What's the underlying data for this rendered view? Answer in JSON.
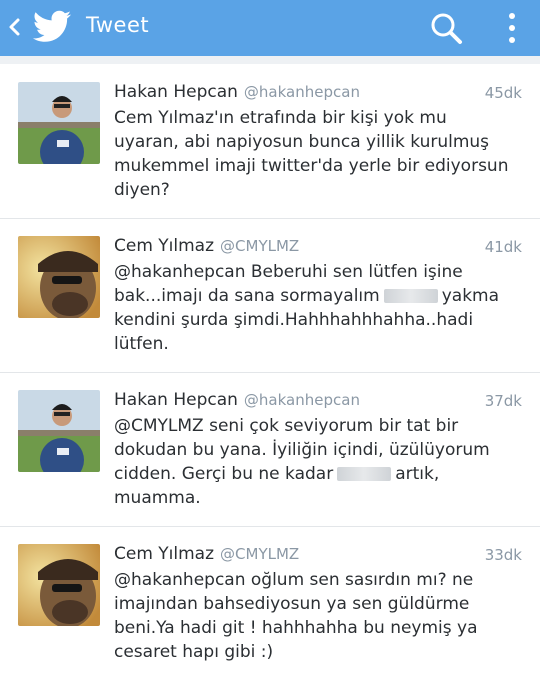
{
  "header": {
    "title": "Tweet",
    "accent_color": "#5aa3e6",
    "icons": [
      "back-chevron-icon",
      "twitter-bird-icon",
      "search-icon",
      "more-vert-icon"
    ]
  },
  "tweets": [
    {
      "name": "Hakan Hepcan",
      "handle": "@hakanhepcan",
      "time": "45dk",
      "text": "Cem Yılmaz'ın etrafında bir kişi yok mu uyaran, abi napiyosun bunca yillik kurulmuş mukemmel imaji twitter'da yerle bir ediyorsun diyen?"
    },
    {
      "name": "Cem Yılmaz",
      "handle": "@CMYLMZ",
      "time": "41dk",
      "text_before": "@hakanhepcan Beberuhi sen lütfen işine bak...imajı da sana sormayalım",
      "text_after": "yakma kendini şurda şimdi.Hahhhahhhahha..hadi lütfen."
    },
    {
      "name": "Hakan Hepcan",
      "handle": "@hakanhepcan",
      "time": "37dk",
      "text_before": "@CMYLMZ seni çok seviyorum bir tat bir dokudan bu yana. İyiliğin içindi, üzülüyorum cidden. Gerçi bu ne kadar",
      "text_after": "artık, muamma."
    },
    {
      "name": "Cem Yılmaz",
      "handle": "@CMYLMZ",
      "time": "33dk",
      "text": "@hakanhepcan oğlum sen sasırdın mı? ne imajından bahsediyosun ya sen güldürme beni.Ya hadi git ! hahhhahha bu neymiş ya cesaret hapı gibi :)"
    }
  ]
}
